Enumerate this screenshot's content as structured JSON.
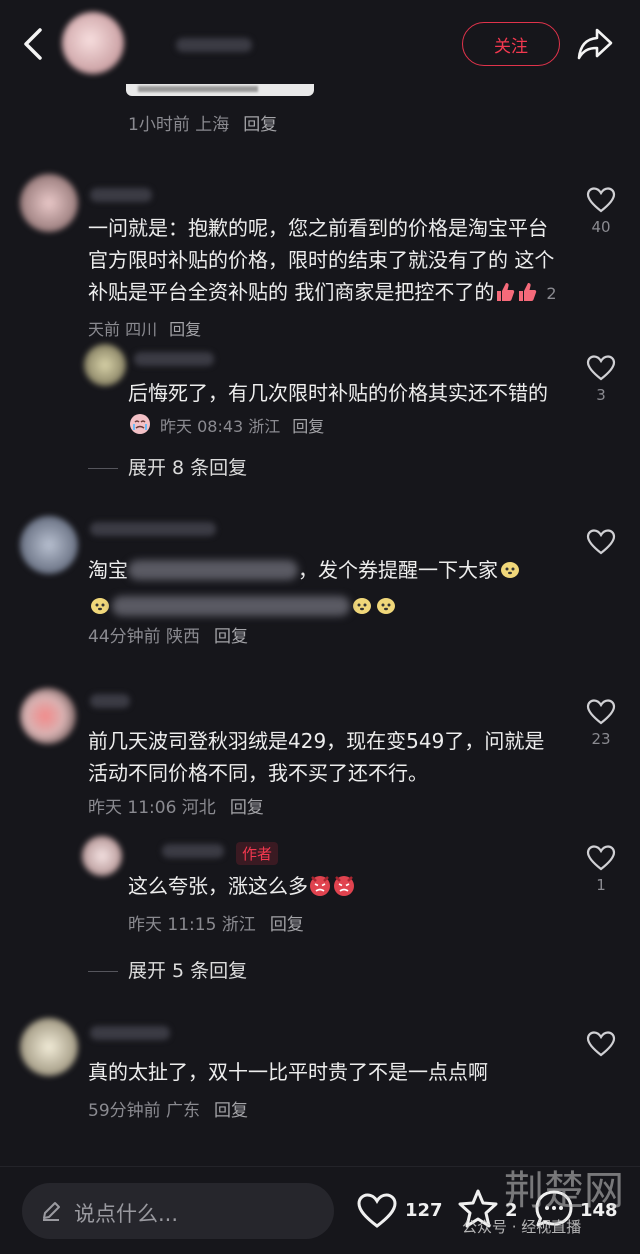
{
  "header": {
    "follow_label": "关注"
  },
  "first_meta": {
    "time_place": "1小时前 上海",
    "reply": "回复"
  },
  "comments": [
    {
      "text": "一问就是：抱歉的呢，您之前看到的价格是淘宝平台官方限时补贴的价格，限时的结束了就没有了的 这个补贴是平台全资补贴的 我们商家是把控不了的",
      "time_place": "2天前 四川",
      "reply": "回复",
      "likes": "40",
      "sub": {
        "text": "后悔死了，有几次限时补贴的价格其实还不错的",
        "time_place": "昨天 08:43 浙江",
        "reply": "回复",
        "likes": "3"
      },
      "expand": "展开 8 条回复"
    },
    {
      "text_a": "淘宝",
      "text_b": "，发个券提醒一下大家",
      "time_place": "44分钟前 陕西",
      "reply": "回复",
      "likes": ""
    },
    {
      "text": "前几天波司登秋羽绒是429，现在变549了，问就是活动不同价格不同，我不买了还不行。",
      "time_place": "昨天 11:06 河北",
      "reply": "回复",
      "likes": "23",
      "sub": {
        "badge": "作者",
        "text": "这么夸张，涨这么多",
        "time_place": "昨天 11:15 浙江",
        "reply": "回复",
        "likes": "1"
      },
      "expand": "展开 5 条回复"
    },
    {
      "text": "真的太扯了，双十一比平时贵了不是一点点啊",
      "time_place": "59分钟前 广东",
      "reply": "回复",
      "likes": ""
    }
  ],
  "bottom": {
    "placeholder": "说点什么...",
    "like_count": "127",
    "star_count": "2",
    "comment_count": "148",
    "watermark_text": "公众号 · 经视直播",
    "watermark_logo": "荆楚网"
  },
  "icons": [
    "back-arrow-icon",
    "share-icon",
    "heart-icon",
    "pen-icon",
    "star-icon",
    "comment-icon",
    "thumbs-up-emoji",
    "crying-emoji",
    "dog-emoji",
    "angry-emoji"
  ],
  "colors": {
    "accent": "#f2384f",
    "background": "#16161b"
  }
}
